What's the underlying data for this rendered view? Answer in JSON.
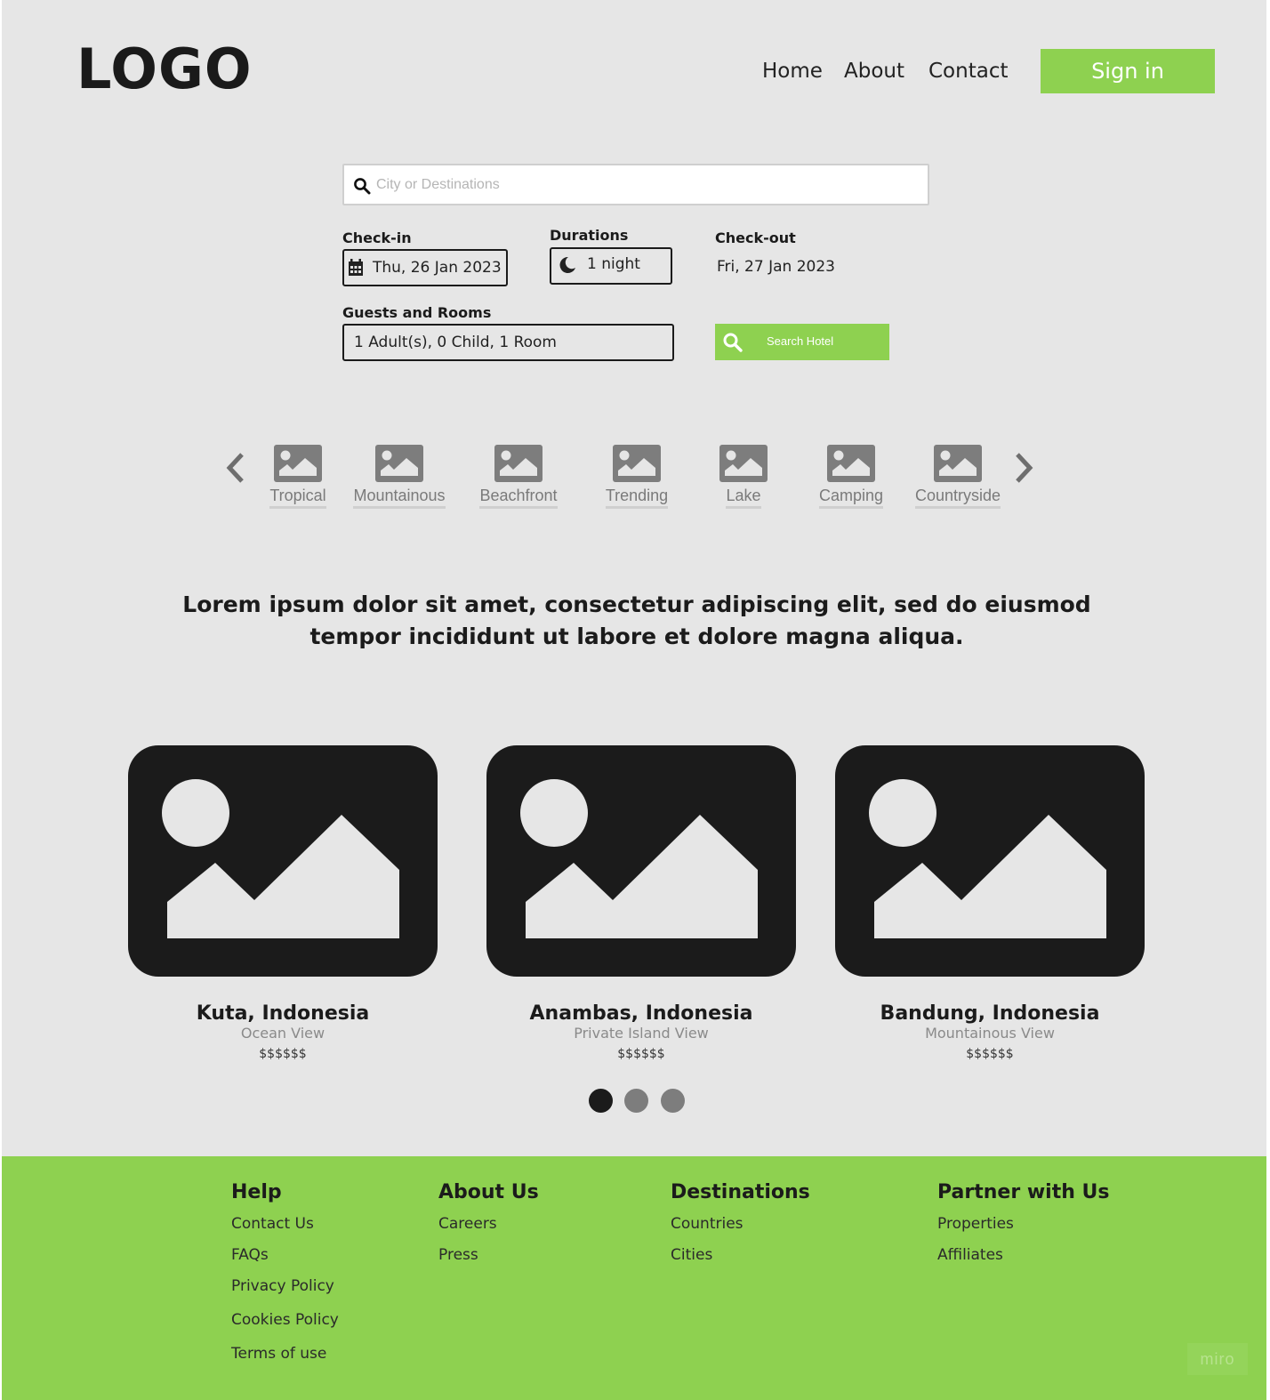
{
  "header": {
    "logo": "LOGO",
    "nav": [
      "Home",
      "About",
      "Contact"
    ],
    "signin_label": "Sign in"
  },
  "search": {
    "placeholder": "City or Destinations",
    "checkin_label": "Check-in",
    "checkin_value": "Thu, 26 Jan 2023",
    "duration_label": "Durations",
    "duration_value": "1 night",
    "checkout_label": "Check-out",
    "checkout_value": "Fri, 27 Jan 2023",
    "guests_label": "Guests and Rooms",
    "guests_value": "1 Adult(s), 0 Child, 1 Room",
    "search_button_label": "Search Hotel"
  },
  "categories": [
    "Tropical",
    "Mountainous",
    "Beachfront",
    "Trending",
    "Lake",
    "Camping",
    "Countryside"
  ],
  "headline": "Lorem ipsum dolor sit amet, consectetur adipiscing elit, sed do eiusmod tempor incididunt ut labore et dolore magna aliqua.",
  "destinations": [
    {
      "title": "Kuta, Indonesia",
      "view": "Ocean View",
      "price": "$$$$$$"
    },
    {
      "title": "Anambas, Indonesia",
      "view": "Private Island View",
      "price": "$$$$$$"
    },
    {
      "title": "Bandung, Indonesia",
      "view": "Mountainous View",
      "price": "$$$$$$"
    }
  ],
  "carousel": {
    "active_index": 0,
    "count": 3
  },
  "footer": {
    "columns": [
      {
        "heading": "Help",
        "links": [
          "Contact Us",
          "FAQs",
          "Privacy Policy",
          "Cookies Policy",
          "Terms of use"
        ]
      },
      {
        "heading": "About Us",
        "links": [
          "Careers",
          "Press"
        ]
      },
      {
        "heading": "Destinations",
        "links": [
          "Countries",
          "Cities"
        ]
      },
      {
        "heading": "Partner with Us",
        "links": [
          "Properties",
          "Affiliates"
        ]
      }
    ]
  },
  "watermark": "miro",
  "colors": {
    "accent": "#8ed150",
    "background": "#e6e6e6",
    "dark": "#1b1b1b",
    "muted": "#7a7a7a"
  },
  "icons": [
    "search-icon",
    "calendar-icon",
    "moon-icon",
    "chevron-left-icon",
    "chevron-right-icon",
    "image-icon"
  ]
}
